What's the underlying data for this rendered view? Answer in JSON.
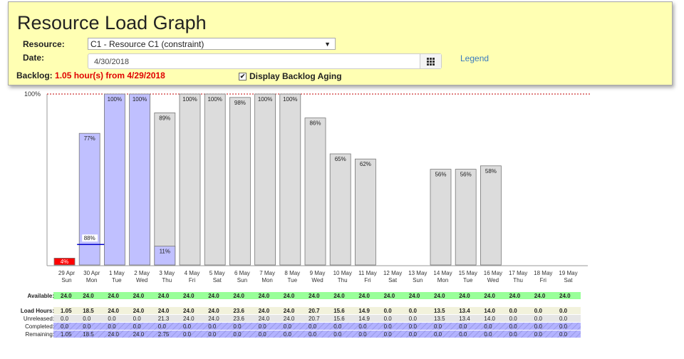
{
  "header": {
    "title": "Resource Load Graph",
    "resource_label": "Resource:",
    "resource_value": "C1 - Resource C1 (constraint)",
    "date_label": "Date:",
    "date_value": "4/30/2018",
    "legend_link": "Legend",
    "backlog_label": "Backlog:",
    "backlog_value": "1.05 hour(s) from 4/29/2018",
    "aging_label": "Display Backlog Aging",
    "aging_checked": true
  },
  "chart_data": {
    "type": "bar",
    "y_top_label": "100%",
    "ylim": [
      0,
      100
    ],
    "categories": [
      {
        "day": "29 Apr",
        "dow": "Sun"
      },
      {
        "day": "30 Apr",
        "dow": "Mon"
      },
      {
        "day": "1 May",
        "dow": "Tue"
      },
      {
        "day": "2 May",
        "dow": "Wed"
      },
      {
        "day": "3 May",
        "dow": "Thu"
      },
      {
        "day": "4 May",
        "dow": "Fri"
      },
      {
        "day": "5 May",
        "dow": "Sat"
      },
      {
        "day": "6 May",
        "dow": "Sun"
      },
      {
        "day": "7 May",
        "dow": "Mon"
      },
      {
        "day": "8 May",
        "dow": "Tue"
      },
      {
        "day": "9 May",
        "dow": "Wed"
      },
      {
        "day": "10 May",
        "dow": "Thu"
      },
      {
        "day": "11 May",
        "dow": "Fri"
      },
      {
        "day": "12 May",
        "dow": "Sat"
      },
      {
        "day": "13 May",
        "dow": "Sun"
      },
      {
        "day": "14 May",
        "dow": "Mon"
      },
      {
        "day": "15 May",
        "dow": "Tue"
      },
      {
        "day": "16 May",
        "dow": "Wed"
      },
      {
        "day": "17 May",
        "dow": "Thu"
      },
      {
        "day": "18 May",
        "dow": "Fri"
      },
      {
        "day": "19 May",
        "dow": "Sat"
      }
    ],
    "values": [
      4,
      77,
      100,
      100,
      89,
      100,
      100,
      98,
      100,
      100,
      86,
      65,
      62,
      0,
      0,
      56,
      56,
      58,
      0,
      0,
      0
    ],
    "labels": [
      "4%",
      "77%",
      "100%",
      "100%",
      "89%",
      "100%",
      "100%",
      "98%",
      "100%",
      "100%",
      "86%",
      "65%",
      "62%",
      "",
      "",
      "56%",
      "56%",
      "58%",
      "",
      "",
      ""
    ],
    "completed_part": [
      0,
      0,
      100,
      100,
      11,
      0,
      0,
      0,
      0,
      0,
      0,
      0,
      0,
      0,
      0,
      0,
      0,
      0,
      0,
      0,
      0
    ],
    "completed_labels": [
      "",
      "",
      "",
      "",
      "11%",
      "",
      "",
      "",
      "",
      "",
      "",
      "",
      "",
      "",
      "",
      "",
      "",
      "",
      "",
      "",
      ""
    ],
    "marker": {
      "index": 1,
      "value": 12,
      "label": "88%"
    },
    "colors": {
      "backlog": "#ff0000",
      "completed": "#c0c0ff",
      "released": "#dcdcdc",
      "marker": "#0000cc",
      "limit": "#c00000"
    }
  },
  "table": {
    "rows": [
      {
        "label": "Available:",
        "bg": "#99ff99",
        "bold": true,
        "values": [
          "24.0",
          "24.0",
          "24.0",
          "24.0",
          "24.0",
          "24.0",
          "24.0",
          "24.0",
          "24.0",
          "24.0",
          "24.0",
          "24.0",
          "24.0",
          "24.0",
          "24.0",
          "24.0",
          "24.0",
          "24.0",
          "24.0",
          "24.0",
          "24.0"
        ]
      },
      {
        "label": "Load Hours:",
        "bg": "#f2f2dc",
        "bold": true,
        "values": [
          "1.05",
          "18.5",
          "24.0",
          "24.0",
          "24.0",
          "24.0",
          "24.0",
          "23.6",
          "24.0",
          "24.0",
          "20.7",
          "15.6",
          "14.9",
          "0.0",
          "0.0",
          "13.5",
          "13.4",
          "14.0",
          "0.0",
          "0.0",
          "0.0"
        ]
      },
      {
        "label": "Unreleased:",
        "bg": "#e6e6e6",
        "bold": false,
        "values": [
          "0.0",
          "0.0",
          "0.0",
          "0.0",
          "21.3",
          "24.0",
          "24.0",
          "23.6",
          "24.0",
          "24.0",
          "20.7",
          "15.6",
          "14.9",
          "0.0",
          "0.0",
          "13.5",
          "13.4",
          "14.0",
          "0.0",
          "0.0",
          "0.0"
        ]
      },
      {
        "label": "Completed:",
        "bg": "#b3b3ff",
        "bold": false,
        "values": [
          "0.0",
          "0.0",
          "0.0",
          "0.0",
          "0.0",
          "0.0",
          "0.0",
          "0.0",
          "0.0",
          "0.0",
          "0.0",
          "0.0",
          "0.0",
          "0.0",
          "0.0",
          "0.0",
          "0.0",
          "0.0",
          "0.0",
          "0.0",
          "0.0"
        ]
      },
      {
        "label": "Remaining:",
        "bg": "#b3b3ff",
        "bold": false,
        "values": [
          "1.05",
          "18.5",
          "24.0",
          "24.0",
          "2.75",
          "0.0",
          "0.0",
          "0.0",
          "0.0",
          "0.0",
          "0.0",
          "0.0",
          "0.0",
          "0.0",
          "0.0",
          "0.0",
          "0.0",
          "0.0",
          "0.0",
          "0.0",
          "0.0"
        ]
      }
    ]
  }
}
